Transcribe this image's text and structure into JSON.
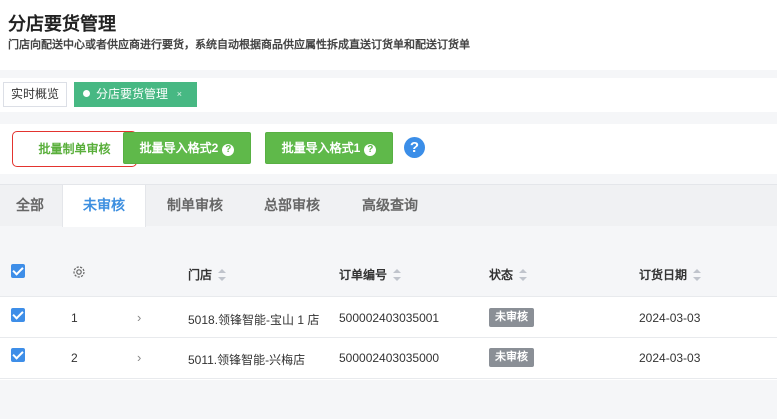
{
  "page": {
    "title": "分店要货管理",
    "subtitle": "门店向配送中心或者供应商进行要货，系统自动根据商品供应属性拆成直送订货单和配送订货单"
  },
  "tabs": {
    "overview": "实时概览",
    "active": "分店要货管理",
    "close": "×"
  },
  "toolbar": {
    "batch_review": "批量制单审核",
    "import_format2": "批量导入格式2",
    "import_format1": "批量导入格式1",
    "help": "?"
  },
  "filters": {
    "all": "全部",
    "pending": "未审核",
    "make_review": "制单审核",
    "hq_review": "总部审核",
    "advanced": "高级查询"
  },
  "table": {
    "headers": {
      "store": "门店",
      "order_no": "订单编号",
      "status": "状态",
      "order_date": "订货日期"
    },
    "rows": [
      {
        "index": "1",
        "store": "5018.领锋智能-宝山 1 店",
        "order_no": "500002403035001",
        "status": "未审核",
        "date": "2024-03-03"
      },
      {
        "index": "2",
        "store": "5011.领锋智能-兴梅店",
        "order_no": "500002403035000",
        "status": "未审核",
        "date": "2024-03-03"
      }
    ]
  },
  "colors": {
    "accent_green": "#5fb94a",
    "tab_green": "#47b883",
    "link_blue": "#3d8fe0",
    "highlight_red": "#e3342f"
  }
}
